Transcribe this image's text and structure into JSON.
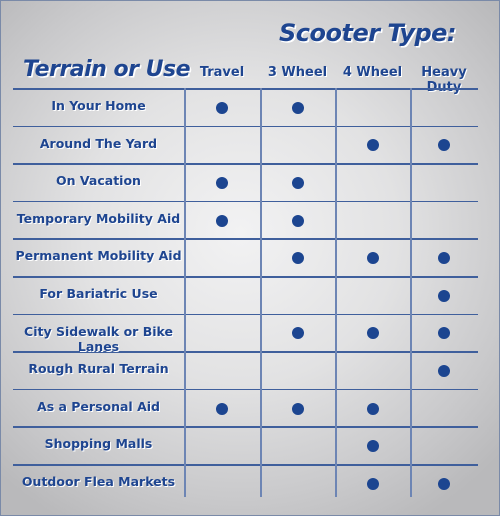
{
  "title": "Scooter Type:",
  "row_header": "Terrain or Use",
  "columns": [
    "Travel",
    "3 Wheel",
    "4 Wheel",
    "Heavy Duty"
  ],
  "rows": [
    {
      "label": "In Your Home",
      "marks": [
        true,
        true,
        false,
        false
      ]
    },
    {
      "label": "Around The Yard",
      "marks": [
        false,
        false,
        true,
        true
      ]
    },
    {
      "label": "On Vacation",
      "marks": [
        true,
        true,
        false,
        false
      ]
    },
    {
      "label": "Temporary Mobility Aid",
      "marks": [
        true,
        true,
        false,
        false
      ]
    },
    {
      "label": "Permanent Mobility Aid",
      "marks": [
        false,
        true,
        true,
        true
      ]
    },
    {
      "label": "For Bariatric Use",
      "marks": [
        false,
        false,
        false,
        true
      ]
    },
    {
      "label": "City Sidewalk or Bike Lanes",
      "marks": [
        false,
        true,
        true,
        true
      ]
    },
    {
      "label": "Rough Rural Terrain",
      "marks": [
        false,
        false,
        false,
        true
      ]
    },
    {
      "label": "As a Personal Aid",
      "marks": [
        true,
        true,
        true,
        false
      ]
    },
    {
      "label": "Shopping Malls",
      "marks": [
        false,
        false,
        true,
        false
      ]
    },
    {
      "label": "Outdoor Flea Markets",
      "marks": [
        false,
        false,
        true,
        true
      ]
    }
  ],
  "colors": {
    "accent": "#1e4590",
    "grid": "#3f5f9c",
    "dot": "#1c4590"
  }
}
